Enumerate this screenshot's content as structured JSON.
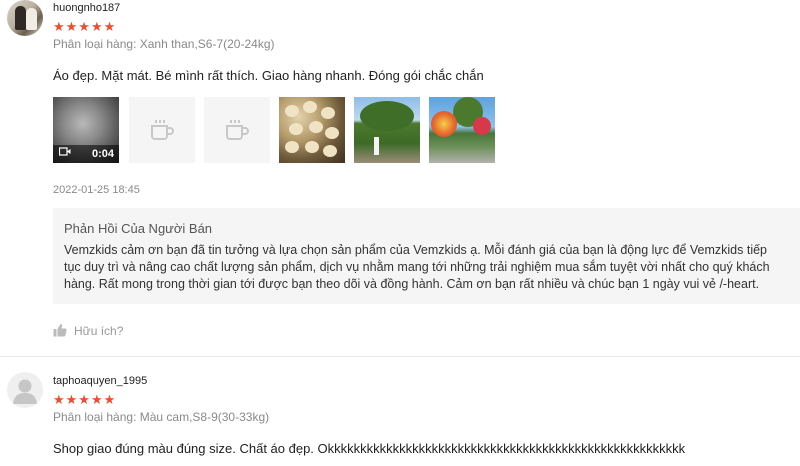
{
  "reviews": [
    {
      "username": "huongnho187",
      "stars": "★★★★★",
      "variant": "Phân loại hàng: Xanh than,S6-7(20-24kg)",
      "comment": "Áo đẹp. Mặt mát. Bé mình rất thích. Giao hàng nhanh. Đóng gói chắc chắn",
      "video_duration": "0:04",
      "timestamp": "2022-01-25 18:45",
      "seller_reply": {
        "title": "Phản Hồi Của Người Bán",
        "text": "Vemzkids cảm ơn bạn đã tin tưởng và lựa chọn sản phẩm của Vemzkids ạ. Mỗi đánh giá của bạn là động lực để Vemzkids tiếp tục duy trì và nâng cao chất lượng sản phẩm, dịch vụ nhằm mang tới những trải nghiệm mua sắm tuyệt vời nhất cho quý khách hàng. Rất mong trong thời gian tới được bạn theo dõi và đồng hành. Cảm ơn bạn rất nhiều và chúc bạn 1 ngày vui vẻ /-heart."
      },
      "helpful_label": "Hữu ích?"
    },
    {
      "username": "taphoaquyen_1995",
      "stars": "★★★★★",
      "variant": "Phân loại hàng: Màu cam,S8-9(30-33kg)",
      "comment": "Shop giao đúng màu đúng size. Chất áo đẹp. Okkkkkkkkkkkkkkkkkkkkkkkkkkkkkkkkkkkkkkkkkkkkkkkkkkkkkkk"
    }
  ],
  "colors": {
    "star": "#ee4d2d",
    "seller_box_bg": "#f5f5f5",
    "muted_text": "#8a8a8a"
  },
  "icons": {
    "video": "video-camera-icon",
    "placeholder": "image-placeholder-icon",
    "helpful": "thumbs-up-icon",
    "default_avatar": "user-icon"
  }
}
